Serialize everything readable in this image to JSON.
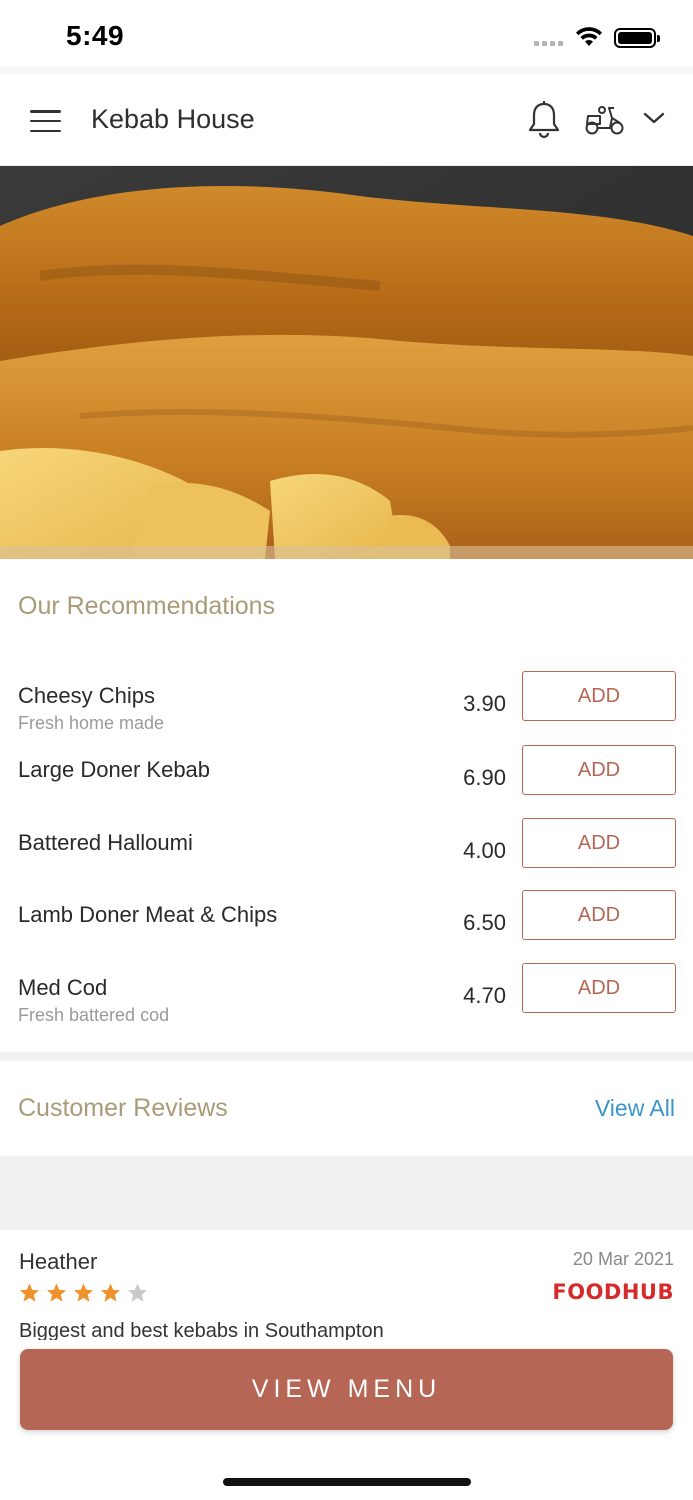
{
  "status_bar": {
    "time": "5:49"
  },
  "header": {
    "title": "Kebab House",
    "icons": [
      "menu-icon",
      "bell-icon",
      "scooter-icon",
      "chevron-down-icon"
    ]
  },
  "hero": {
    "image": "fish-and-chips-photo"
  },
  "recommendations": {
    "title": "Our Recommendations",
    "items": [
      {
        "name": "Cheesy Chips",
        "description": "Fresh home made",
        "price": "3.90",
        "button": "ADD"
      },
      {
        "name": "Large Doner Kebab",
        "description": "",
        "price": "6.90",
        "button": "ADD"
      },
      {
        "name": "Battered Halloumi",
        "description": "",
        "price": "4.00",
        "button": "ADD"
      },
      {
        "name": "Lamb Doner Meat & Chips",
        "description": "",
        "price": "6.50",
        "button": "ADD"
      },
      {
        "name": "Med Cod",
        "description": "Fresh battered cod",
        "price": "4.70",
        "button": "ADD"
      }
    ]
  },
  "reviews": {
    "title": "Customer Reviews",
    "view_all": "View All",
    "items": [
      {
        "name": "Heather",
        "date": "20 Mar 2021",
        "rating": 4,
        "max_rating": 5,
        "source": "FOODHUB",
        "text": "Biggest and best kebabs in Southampton"
      }
    ]
  },
  "footer": {
    "view_menu": "VIEW MENU"
  },
  "colors": {
    "accent": "#b56655",
    "section_title": "#a99a78",
    "link": "#3a95c9",
    "star_filled": "#f0922b",
    "star_empty": "#c9c9c9",
    "foodhub_red": "#d62b2b"
  }
}
